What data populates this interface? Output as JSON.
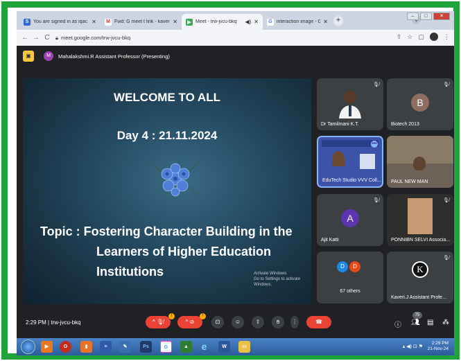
{
  "browser": {
    "tabs": [
      {
        "label": "You are signed in as iqac",
        "icon": "skype-icon",
        "color": "#2f6bd8",
        "glyph": "S",
        "active": false
      },
      {
        "label": "Fwd: G meet t link - kaveri@vvvc",
        "icon": "gmail-icon",
        "color": "#ffffff",
        "glyph": "M",
        "active": false
      },
      {
        "label": "Meet - trw-jvcu-bkq",
        "icon": "meet-icon",
        "color": "#34a853",
        "glyph": "▶",
        "active": true
      },
      {
        "label": "interaction image - Google Sea",
        "icon": "google-icon",
        "color": "#ffffff",
        "glyph": "G",
        "active": false
      }
    ],
    "url": "meet.google.com/trw-jvcu-bkq"
  },
  "presenting": {
    "avatar_initial": "M",
    "text": "Mahalakshmi.R Assistant Professor (Presenting)"
  },
  "slide": {
    "title": "WELCOME TO ALL",
    "day": "Day 4 : 21.11.2024",
    "topic_line1": "Topic  :  Fostering Character Building in the",
    "topic_line2": "Learners of Higher Education",
    "topic_line3": "Institutions",
    "watermark_line1": "Activate Windows",
    "watermark_line2": "Go to Settings to activate Windows."
  },
  "participants": [
    {
      "name": "Dr Tamilmani K.T.",
      "type": "photo"
    },
    {
      "name": "Biotech 2013",
      "type": "initial",
      "initial": "B",
      "color": "#8d6e63"
    },
    {
      "name": "EduTech Studio VVV Coll...",
      "type": "screen"
    },
    {
      "name": "PAUL NEW MAN",
      "type": "photo"
    },
    {
      "name": "Ajit Katti",
      "type": "initial",
      "initial": "A",
      "color": "#5e35b1"
    },
    {
      "name": "PONNIBN SELVI Associa...",
      "type": "photo"
    },
    {
      "name": "67 others",
      "type": "others",
      "initials": [
        "D",
        "D"
      ]
    },
    {
      "name": "Kaveri.J Assistant Profe...",
      "type": "photo"
    }
  ],
  "bottom": {
    "time": "2:29 PM",
    "meeting_code": "trw-jvcu-bkq",
    "participant_count": "75"
  },
  "taskbar": {
    "time": "2:29 PM",
    "date": "21-Nov-24"
  }
}
